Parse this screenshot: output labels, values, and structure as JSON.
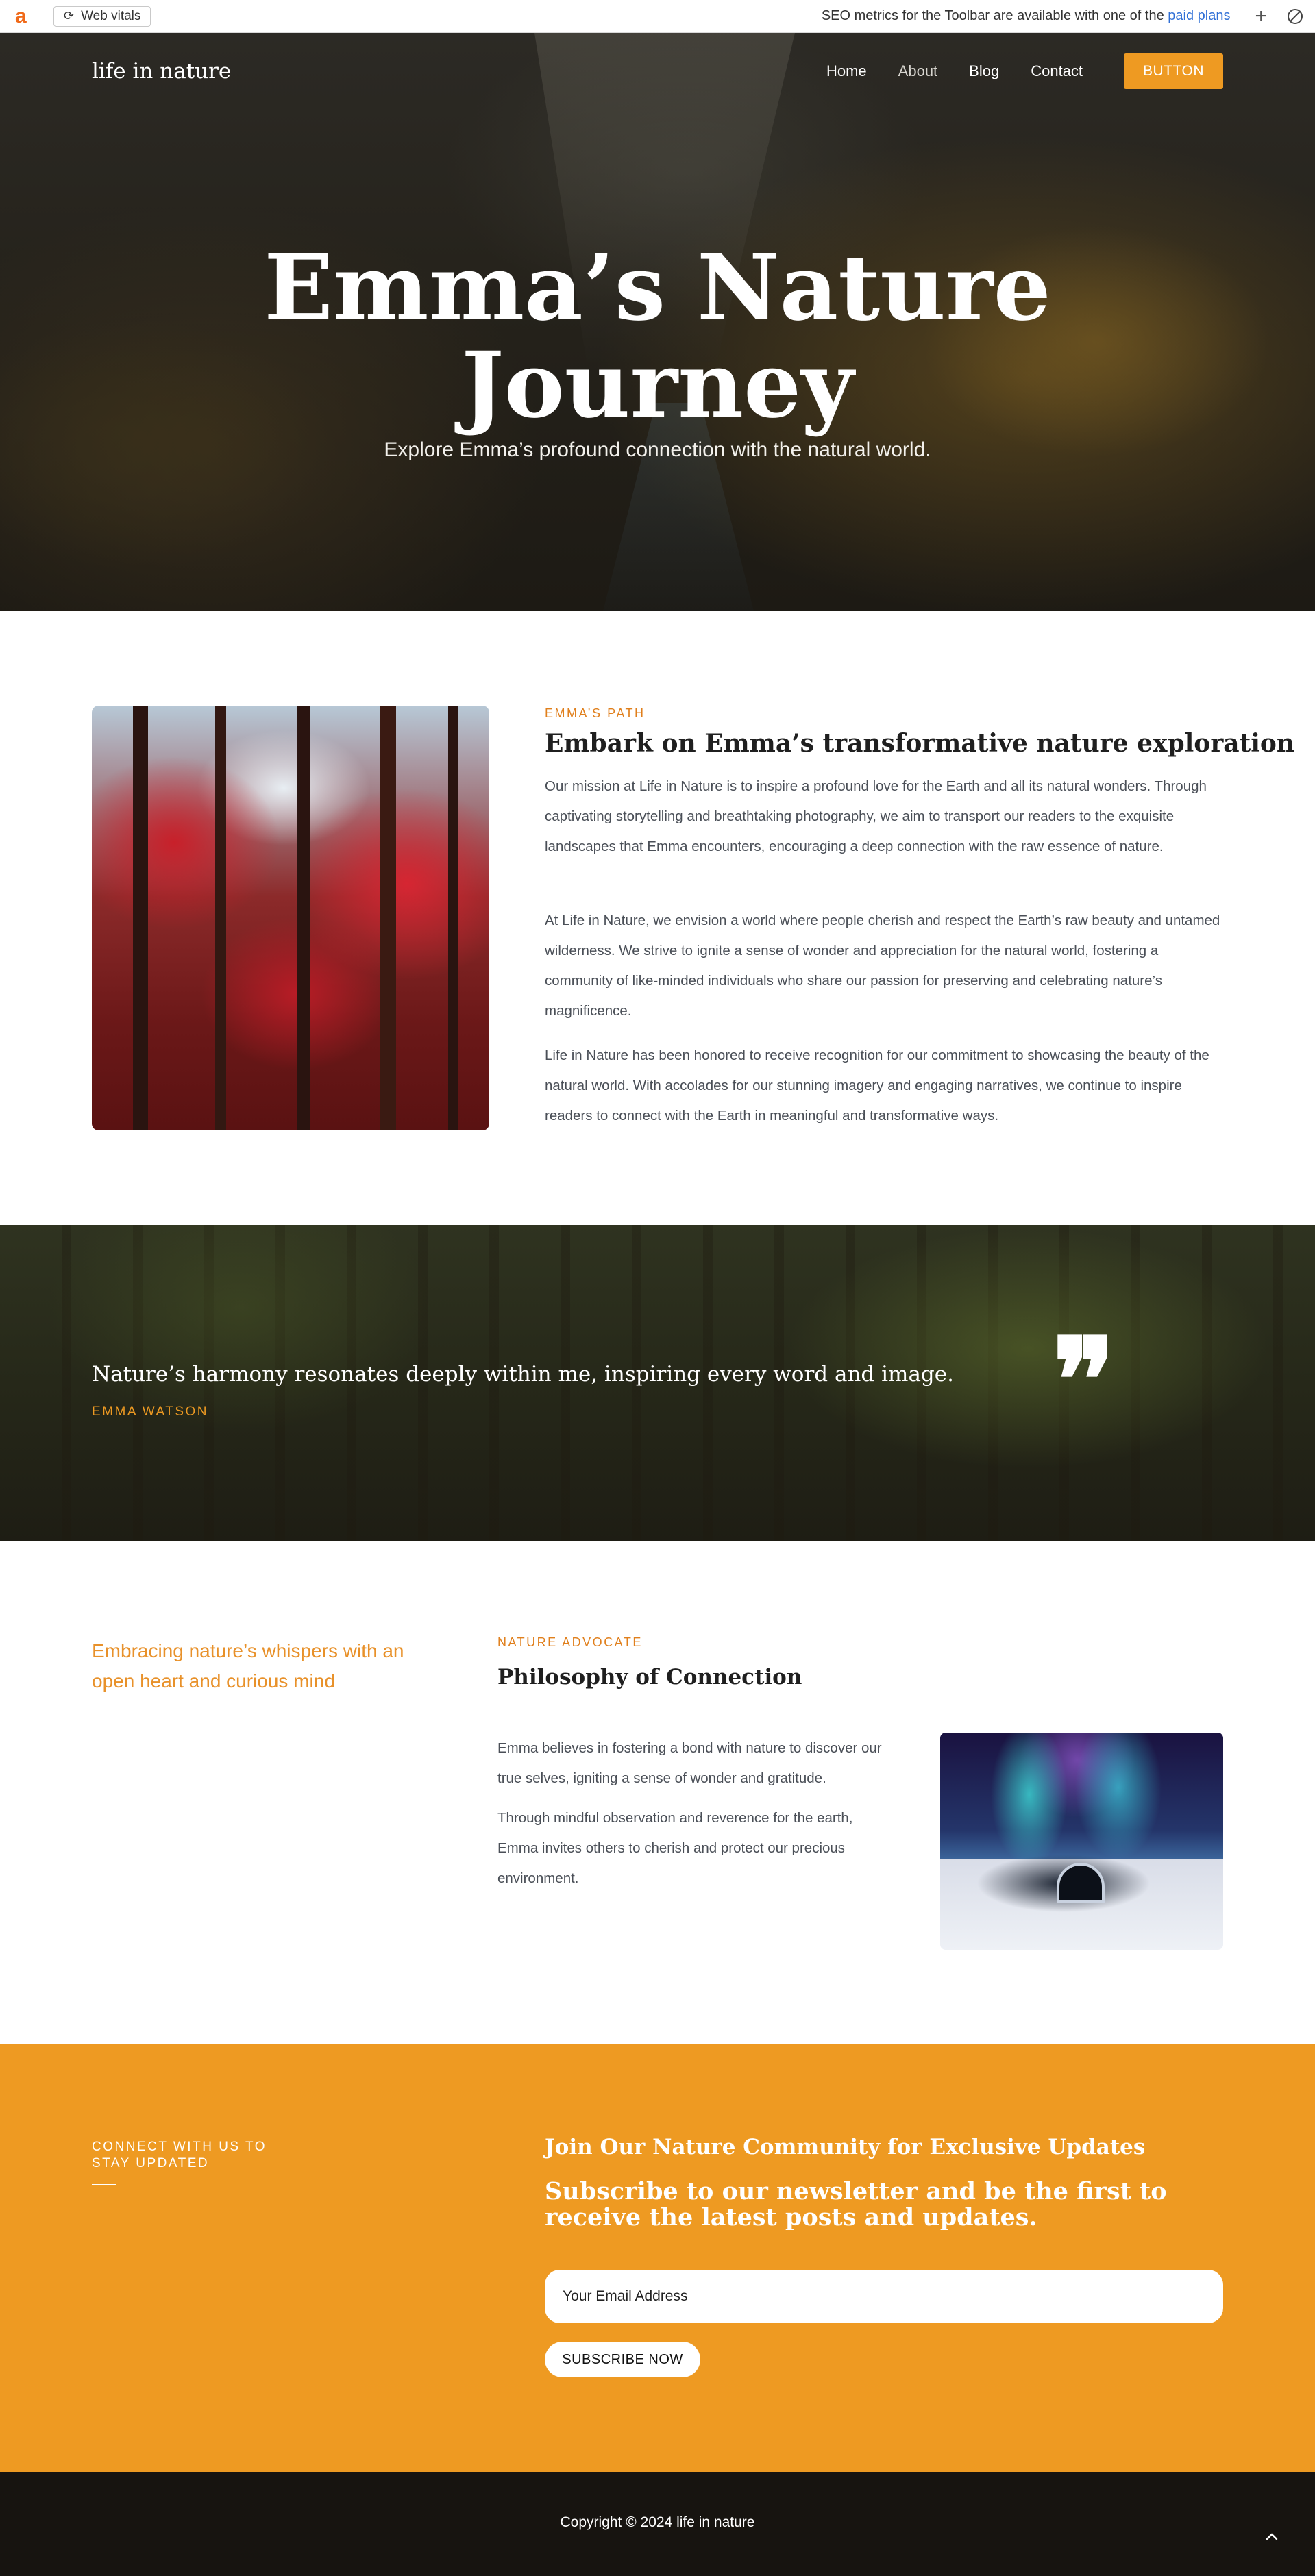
{
  "toolbar": {
    "logo": "a",
    "vitals_label": "Web vitals",
    "message": "SEO metrics for the Toolbar are available with one of the",
    "link": "paid plans",
    "add_icon": "plus-icon",
    "close_icon": "block-icon"
  },
  "nav": {
    "brand": "life in nature",
    "items": [
      "Home",
      "About",
      "Blog",
      "Contact"
    ],
    "button": "BUTTON"
  },
  "hero": {
    "title_line1": "Emma’s Nature",
    "title_line2": "Journey",
    "subtitle": "Explore Emma’s profound connection with the natural world."
  },
  "about": {
    "eyebrow": "EMMA’S PATH",
    "title": "Embark on Emma’s transformative nature exploration",
    "paragraphs": [
      "Our mission at Life in Nature is to inspire a profound love for the Earth and all its natural wonders. Through captivating storytelling and breathtaking photography, we aim to transport our readers to the exquisite landscapes that Emma encounters, encouraging a deep connection with the raw essence of nature.",
      "At Life in Nature, we envision a world where people cherish and respect the Earth’s raw beauty and untamed wilderness. We strive to ignite a sense of wonder and appreciation for the natural world, fostering a community of like-minded individuals who share our passion for preserving and celebrating nature’s magnificence.",
      "Life in Nature has been honored to receive recognition for our commitment to showcasing the beauty of the natural world. With accolades for our stunning imagery and engaging narratives, we continue to inspire readers to connect with the Earth in meaningful and transformative ways."
    ]
  },
  "quote": {
    "text": "Nature’s harmony resonates deeply within me, inspiring every word and image.",
    "author": "EMMA WATSON",
    "mark": "❞"
  },
  "philosophy": {
    "lead": "Embracing nature’s whispers with an open heart and curious mind",
    "eyebrow": "NATURE ADVOCATE",
    "title": "Philosophy of Connection",
    "paragraphs": [
      "Emma believes in fostering a bond with nature to discover our true selves, igniting a sense of wonder and gratitude.",
      "Through mindful observation and reverence for the earth, Emma invites others to cherish and protect our precious environment."
    ]
  },
  "newsletter": {
    "eyebrow": "CONNECT WITH US TO STAY UPDATED",
    "heading": "Join Our Nature Community for Exclusive Updates",
    "subheading": "Subscribe to our newsletter and be the first to receive the latest posts and updates.",
    "email_placeholder": "Your Email Address",
    "button": "SUBSCRIBE NOW"
  },
  "footer": {
    "copyright": "Copyright © 2024 life in nature"
  },
  "colors": {
    "accent": "#ee9a22",
    "footer_bg": "#171410",
    "body_text": "#4a4f57"
  }
}
